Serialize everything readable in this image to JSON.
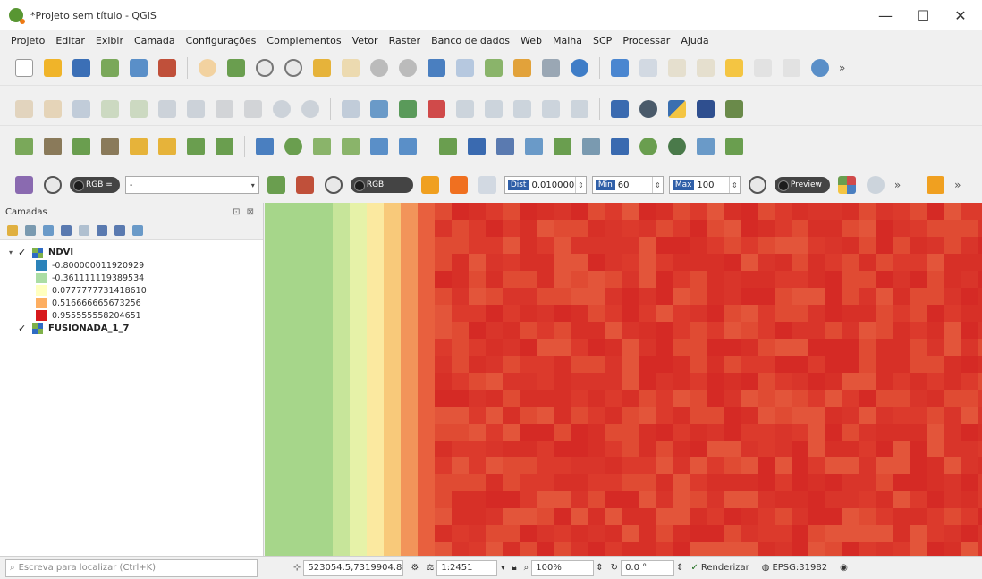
{
  "window": {
    "title": "*Projeto sem título - QGIS",
    "minimize": "—",
    "maximize": "☐",
    "close": "✕"
  },
  "menu": [
    "Projeto",
    "Editar",
    "Exibir",
    "Camada",
    "Configurações",
    "Complementos",
    "Vetor",
    "Raster",
    "Banco de dados",
    "Web",
    "Malha",
    "SCP",
    "Processar",
    "Ajuda"
  ],
  "scp_toolbar": {
    "rgb_label": "RGB =",
    "rgb_value": "-",
    "rgb_pill": "RGB",
    "dist_label": "Dist",
    "dist_value": "0.010000",
    "min_label": "Min",
    "min_value": "60",
    "max_label": "Max",
    "max_value": "100",
    "preview_label": "Preview"
  },
  "layers_panel": {
    "title": "Camadas",
    "header_controls": "⊡ ⊠",
    "layers": [
      {
        "name": "NDVI",
        "checked": "✓",
        "expander": "▾",
        "legend": [
          {
            "label": "-0.800000011920929",
            "color": "#2b83ba"
          },
          {
            "label": "-0.361111119389534",
            "color": "#abdda4"
          },
          {
            "label": "0.0777777731418610",
            "color": "#ffffbf"
          },
          {
            "label": "0.516666665673256",
            "color": "#fdae61"
          },
          {
            "label": "0.955555558204651",
            "color": "#d7191c"
          }
        ]
      },
      {
        "name": "FUSIONADA_1_7",
        "checked": "✓",
        "expander": ""
      }
    ]
  },
  "statusbar": {
    "locator_placeholder": "Escreva para localizar (Ctrl+K)",
    "coordinate": "523054.5,7319904.8",
    "scale": "1:2451",
    "magnifier": "100%",
    "rotation": "0.0 °",
    "render_label": "Renderizar",
    "render_checked": "✓",
    "crs": "EPSG:31982"
  },
  "map": {
    "columns": [
      {
        "color": "#a6d68a",
        "count": 4
      },
      {
        "color": "#c7e59a",
        "count": 1
      },
      {
        "color": "#e6f2a8",
        "count": 1
      },
      {
        "color": "#fbe9a0",
        "count": 1
      },
      {
        "color": "#f8c97a",
        "count": 1
      },
      {
        "color": "#f2945a",
        "count": 1
      },
      {
        "color": "#e8603e",
        "count": 1
      }
    ],
    "red_tones": [
      "#d73027",
      "#dc3a2c",
      "#e04b33",
      "#d52a25",
      "#e3553a",
      "#d9352a"
    ]
  }
}
